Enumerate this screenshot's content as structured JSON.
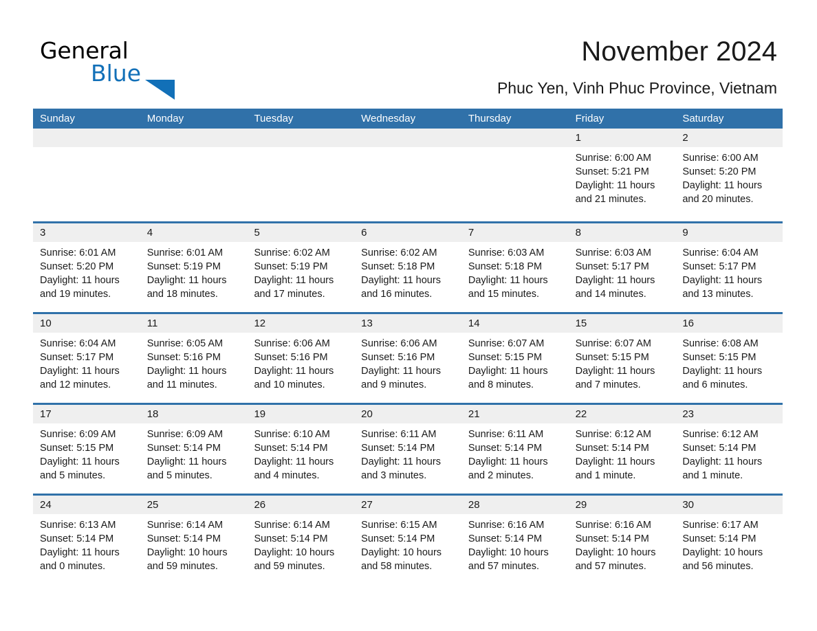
{
  "brand": {
    "name_part1": "General",
    "name_part2": "Blue",
    "triangle_icon": "triangle-icon",
    "accent_color": "#1270b8"
  },
  "header": {
    "title": "November 2024",
    "subtitle": "Phuc Yen, Vinh Phuc Province, Vietnam"
  },
  "colors": {
    "header_blue": "#3071a9",
    "day_header_gray": "#efefef",
    "text": "#1a1a1a"
  },
  "calendar": {
    "weekdays": [
      "Sunday",
      "Monday",
      "Tuesday",
      "Wednesday",
      "Thursday",
      "Friday",
      "Saturday"
    ],
    "weeks": [
      [
        {
          "empty": true
        },
        {
          "empty": true
        },
        {
          "empty": true
        },
        {
          "empty": true
        },
        {
          "empty": true
        },
        {
          "day": "1",
          "sunrise": "Sunrise: 6:00 AM",
          "sunset": "Sunset: 5:21 PM",
          "daylight": "Daylight: 11 hours and 21 minutes."
        },
        {
          "day": "2",
          "sunrise": "Sunrise: 6:00 AM",
          "sunset": "Sunset: 5:20 PM",
          "daylight": "Daylight: 11 hours and 20 minutes."
        }
      ],
      [
        {
          "day": "3",
          "sunrise": "Sunrise: 6:01 AM",
          "sunset": "Sunset: 5:20 PM",
          "daylight": "Daylight: 11 hours and 19 minutes."
        },
        {
          "day": "4",
          "sunrise": "Sunrise: 6:01 AM",
          "sunset": "Sunset: 5:19 PM",
          "daylight": "Daylight: 11 hours and 18 minutes."
        },
        {
          "day": "5",
          "sunrise": "Sunrise: 6:02 AM",
          "sunset": "Sunset: 5:19 PM",
          "daylight": "Daylight: 11 hours and 17 minutes."
        },
        {
          "day": "6",
          "sunrise": "Sunrise: 6:02 AM",
          "sunset": "Sunset: 5:18 PM",
          "daylight": "Daylight: 11 hours and 16 minutes."
        },
        {
          "day": "7",
          "sunrise": "Sunrise: 6:03 AM",
          "sunset": "Sunset: 5:18 PM",
          "daylight": "Daylight: 11 hours and 15 minutes."
        },
        {
          "day": "8",
          "sunrise": "Sunrise: 6:03 AM",
          "sunset": "Sunset: 5:17 PM",
          "daylight": "Daylight: 11 hours and 14 minutes."
        },
        {
          "day": "9",
          "sunrise": "Sunrise: 6:04 AM",
          "sunset": "Sunset: 5:17 PM",
          "daylight": "Daylight: 11 hours and 13 minutes."
        }
      ],
      [
        {
          "day": "10",
          "sunrise": "Sunrise: 6:04 AM",
          "sunset": "Sunset: 5:17 PM",
          "daylight": "Daylight: 11 hours and 12 minutes."
        },
        {
          "day": "11",
          "sunrise": "Sunrise: 6:05 AM",
          "sunset": "Sunset: 5:16 PM",
          "daylight": "Daylight: 11 hours and 11 minutes."
        },
        {
          "day": "12",
          "sunrise": "Sunrise: 6:06 AM",
          "sunset": "Sunset: 5:16 PM",
          "daylight": "Daylight: 11 hours and 10 minutes."
        },
        {
          "day": "13",
          "sunrise": "Sunrise: 6:06 AM",
          "sunset": "Sunset: 5:16 PM",
          "daylight": "Daylight: 11 hours and 9 minutes."
        },
        {
          "day": "14",
          "sunrise": "Sunrise: 6:07 AM",
          "sunset": "Sunset: 5:15 PM",
          "daylight": "Daylight: 11 hours and 8 minutes."
        },
        {
          "day": "15",
          "sunrise": "Sunrise: 6:07 AM",
          "sunset": "Sunset: 5:15 PM",
          "daylight": "Daylight: 11 hours and 7 minutes."
        },
        {
          "day": "16",
          "sunrise": "Sunrise: 6:08 AM",
          "sunset": "Sunset: 5:15 PM",
          "daylight": "Daylight: 11 hours and 6 minutes."
        }
      ],
      [
        {
          "day": "17",
          "sunrise": "Sunrise: 6:09 AM",
          "sunset": "Sunset: 5:15 PM",
          "daylight": "Daylight: 11 hours and 5 minutes."
        },
        {
          "day": "18",
          "sunrise": "Sunrise: 6:09 AM",
          "sunset": "Sunset: 5:14 PM",
          "daylight": "Daylight: 11 hours and 5 minutes."
        },
        {
          "day": "19",
          "sunrise": "Sunrise: 6:10 AM",
          "sunset": "Sunset: 5:14 PM",
          "daylight": "Daylight: 11 hours and 4 minutes."
        },
        {
          "day": "20",
          "sunrise": "Sunrise: 6:11 AM",
          "sunset": "Sunset: 5:14 PM",
          "daylight": "Daylight: 11 hours and 3 minutes."
        },
        {
          "day": "21",
          "sunrise": "Sunrise: 6:11 AM",
          "sunset": "Sunset: 5:14 PM",
          "daylight": "Daylight: 11 hours and 2 minutes."
        },
        {
          "day": "22",
          "sunrise": "Sunrise: 6:12 AM",
          "sunset": "Sunset: 5:14 PM",
          "daylight": "Daylight: 11 hours and 1 minute."
        },
        {
          "day": "23",
          "sunrise": "Sunrise: 6:12 AM",
          "sunset": "Sunset: 5:14 PM",
          "daylight": "Daylight: 11 hours and 1 minute."
        }
      ],
      [
        {
          "day": "24",
          "sunrise": "Sunrise: 6:13 AM",
          "sunset": "Sunset: 5:14 PM",
          "daylight": "Daylight: 11 hours and 0 minutes."
        },
        {
          "day": "25",
          "sunrise": "Sunrise: 6:14 AM",
          "sunset": "Sunset: 5:14 PM",
          "daylight": "Daylight: 10 hours and 59 minutes."
        },
        {
          "day": "26",
          "sunrise": "Sunrise: 6:14 AM",
          "sunset": "Sunset: 5:14 PM",
          "daylight": "Daylight: 10 hours and 59 minutes."
        },
        {
          "day": "27",
          "sunrise": "Sunrise: 6:15 AM",
          "sunset": "Sunset: 5:14 PM",
          "daylight": "Daylight: 10 hours and 58 minutes."
        },
        {
          "day": "28",
          "sunrise": "Sunrise: 6:16 AM",
          "sunset": "Sunset: 5:14 PM",
          "daylight": "Daylight: 10 hours and 57 minutes."
        },
        {
          "day": "29",
          "sunrise": "Sunrise: 6:16 AM",
          "sunset": "Sunset: 5:14 PM",
          "daylight": "Daylight: 10 hours and 57 minutes."
        },
        {
          "day": "30",
          "sunrise": "Sunrise: 6:17 AM",
          "sunset": "Sunset: 5:14 PM",
          "daylight": "Daylight: 10 hours and 56 minutes."
        }
      ]
    ]
  }
}
